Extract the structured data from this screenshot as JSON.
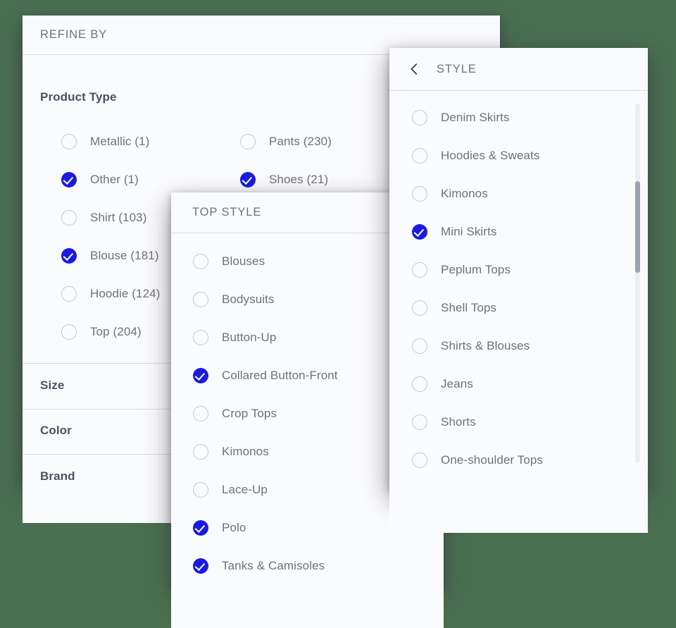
{
  "background_color": "#4a7050",
  "accent_color": "#1a1ae2",
  "refine_panel": {
    "title": "REFINE BY",
    "sections": [
      {
        "label": "Product Type"
      },
      {
        "label": "Size"
      },
      {
        "label": "Color"
      },
      {
        "label": "Brand"
      }
    ],
    "product_type_options_left": [
      {
        "label": "Metallic (1)",
        "checked": false
      },
      {
        "label": "Other (1)",
        "checked": true
      },
      {
        "label": "Shirt (103)",
        "checked": false
      },
      {
        "label": "Blouse (181)",
        "checked": true
      },
      {
        "label": "Hoodie (124)",
        "checked": false
      },
      {
        "label": "Top (204)",
        "checked": false
      }
    ],
    "product_type_options_right": [
      {
        "label": "Pants (230)",
        "checked": false
      },
      {
        "label": "Shoes (21)",
        "checked": true
      }
    ]
  },
  "top_style_panel": {
    "title": "TOP STYLE",
    "options": [
      {
        "label": "Blouses",
        "checked": false
      },
      {
        "label": "Bodysuits",
        "checked": false
      },
      {
        "label": "Button-Up",
        "checked": false
      },
      {
        "label": "Collared Button-Front",
        "checked": true
      },
      {
        "label": "Crop Tops",
        "checked": false
      },
      {
        "label": "Kimonos",
        "checked": false
      },
      {
        "label": "Lace-Up",
        "checked": false
      },
      {
        "label": "Polo",
        "checked": true
      },
      {
        "label": "Tanks & Camisoles",
        "checked": true
      }
    ]
  },
  "style_panel": {
    "title": "STYLE",
    "back_icon": "chevron-left-icon",
    "options": [
      {
        "label": "Denim Skirts",
        "checked": false
      },
      {
        "label": "Hoodies & Sweats",
        "checked": false
      },
      {
        "label": "Kimonos",
        "checked": false
      },
      {
        "label": "Mini Skirts",
        "checked": true
      },
      {
        "label": "Peplum Tops",
        "checked": false
      },
      {
        "label": "Shell Tops",
        "checked": false
      },
      {
        "label": "Shirts & Blouses",
        "checked": false
      },
      {
        "label": "Jeans",
        "checked": false
      },
      {
        "label": "Shorts",
        "checked": false
      },
      {
        "label": "One-shoulder Tops",
        "checked": false
      }
    ],
    "scrollbar": {
      "track_color": "#eceef0",
      "thumb_color": "#9ba2b3"
    }
  }
}
